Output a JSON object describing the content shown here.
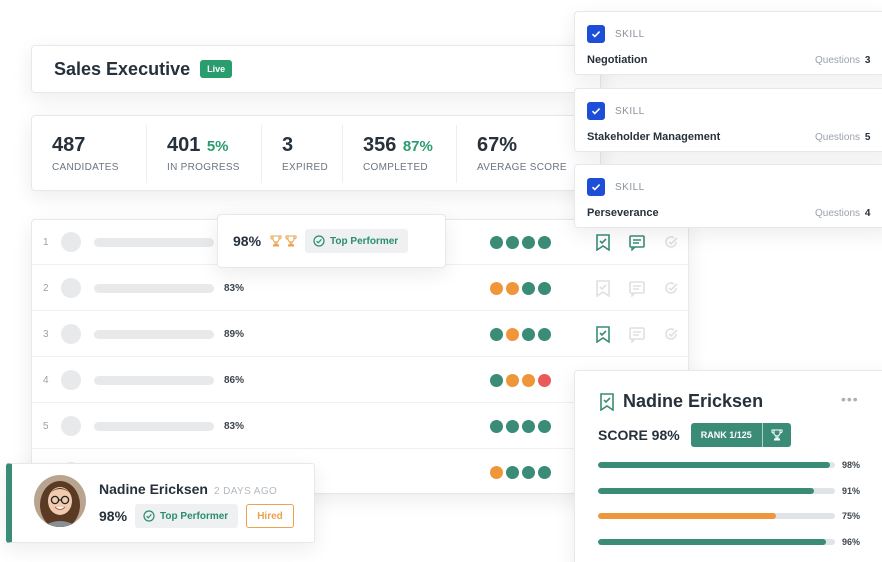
{
  "job": {
    "title": "Sales Executive",
    "status": "Live"
  },
  "stats": [
    {
      "value": "487",
      "pct": "",
      "label": "CANDIDATES"
    },
    {
      "value": "401",
      "pct": "5%",
      "label": "IN PROGRESS"
    },
    {
      "value": "3",
      "pct": "",
      "label": "EXPIRED"
    },
    {
      "value": "356",
      "pct": "87%",
      "label": "COMPLETED"
    },
    {
      "value": "67%",
      "pct": "",
      "label": "AVERAGE SCORE"
    }
  ],
  "candidates": [
    {
      "rank": "1",
      "score": "",
      "dots": [
        "#3a8c76",
        "#3a8c76",
        "#3a8c76",
        "#3a8c76"
      ],
      "icons_active": [
        true,
        true,
        false
      ]
    },
    {
      "rank": "2",
      "score": "83%",
      "dots": [
        "#f0963a",
        "#f0963a",
        "#3a8c76",
        "#3a8c76"
      ],
      "icons_active": [
        false,
        false,
        false
      ]
    },
    {
      "rank": "3",
      "score": "89%",
      "dots": [
        "#3a8c76",
        "#f0963a",
        "#3a8c76",
        "#3a8c76"
      ],
      "icons_active": [
        true,
        false,
        false
      ]
    },
    {
      "rank": "4",
      "score": "86%",
      "dots": [
        "#3a8c76",
        "#f0963a",
        "#f0963a",
        "#ea5a5a"
      ],
      "icons_active": [
        false,
        false,
        false
      ]
    },
    {
      "rank": "5",
      "score": "83%",
      "dots": [
        "#3a8c76",
        "#3a8c76",
        "#3a8c76",
        "#3a8c76"
      ],
      "icons_active": [
        false,
        false,
        false
      ]
    },
    {
      "rank": "",
      "score": "",
      "dots": [
        "#f0963a",
        "#3a8c76",
        "#3a8c76",
        "#3a8c76"
      ],
      "icons_active": [
        false,
        false,
        false
      ]
    }
  ],
  "popup": {
    "score": "98%",
    "badge": "Top Performer"
  },
  "skills": [
    {
      "tag": "SKILL",
      "name": "Negotiation",
      "questions_label": "Questions",
      "questions": "3"
    },
    {
      "tag": "SKILL",
      "name": "Stakeholder Management",
      "questions_label": "Questions",
      "questions": "5"
    },
    {
      "tag": "SKILL",
      "name": "Perseverance",
      "questions_label": "Questions",
      "questions": "4"
    }
  ],
  "profile": {
    "name": "Nadine Ericksen",
    "score_label": "SCORE 98%",
    "rank": "RANK 1/125",
    "bars": [
      {
        "value": 98,
        "label": "98%",
        "color": "#3a8c76"
      },
      {
        "value": 91,
        "label": "91%",
        "color": "#3a8c76"
      },
      {
        "value": 75,
        "label": "75%",
        "color": "#f0963a"
      },
      {
        "value": 96,
        "label": "96%",
        "color": "#3a8c76"
      }
    ]
  },
  "hired_card": {
    "name": "Nadine Ericksen",
    "time": "2 DAYS AGO",
    "score": "98%",
    "badge": "Top Performer",
    "status": "Hired"
  },
  "colors": {
    "green": "#3a8c76",
    "orange": "#f0963a",
    "red": "#ea5a5a",
    "blue": "#1d4ed8"
  }
}
